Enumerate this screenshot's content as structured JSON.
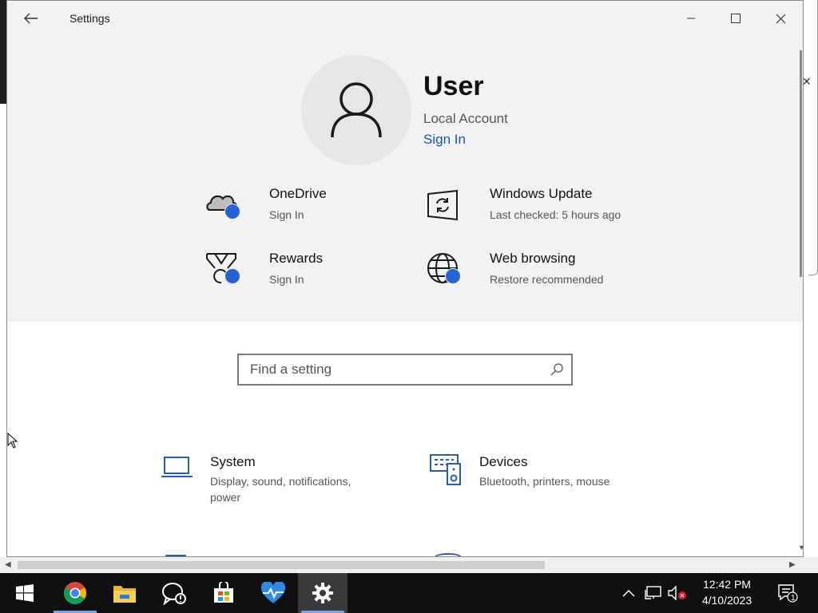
{
  "window": {
    "title": "Settings",
    "back_label": "Back",
    "minimize_label": "Minimize",
    "maximize_label": "Maximize",
    "close_label": "Close"
  },
  "profile": {
    "name": "User",
    "account_type": "Local Account",
    "sign_in": "Sign In"
  },
  "quick_tiles": [
    {
      "icon": "onedrive-cloud-icon",
      "title": "OneDrive",
      "subtitle": "Sign In"
    },
    {
      "icon": "windows-update-icon",
      "title": "Windows Update",
      "subtitle": "Last checked: 5 hours ago"
    },
    {
      "icon": "rewards-medal-icon",
      "title": "Rewards",
      "subtitle": "Sign In"
    },
    {
      "icon": "web-browsing-globe-icon",
      "title": "Web browsing",
      "subtitle": "Restore recommended"
    }
  ],
  "search": {
    "placeholder": "Find a setting"
  },
  "categories": [
    {
      "icon": "laptop-icon",
      "title": "System",
      "subtitle": "Display, sound, notifications, power"
    },
    {
      "icon": "devices-icon",
      "title": "Devices",
      "subtitle": "Bluetooth, printers, mouse"
    }
  ],
  "taskbar": {
    "apps": [
      {
        "icon": "windows-start-icon",
        "name": "Start"
      },
      {
        "icon": "chrome-icon",
        "name": "Google Chrome"
      },
      {
        "icon": "file-explorer-icon",
        "name": "File Explorer"
      },
      {
        "icon": "feedback-hub-icon",
        "name": "Feedback Hub"
      },
      {
        "icon": "microsoft-store-icon",
        "name": "Microsoft Store"
      },
      {
        "icon": "health-monitor-icon",
        "name": "Health"
      },
      {
        "icon": "settings-gear-icon",
        "name": "Settings"
      }
    ],
    "time": "12:42 PM",
    "date": "4/10/2023",
    "notification_count": "1"
  },
  "colors": {
    "accent": "#2563d6",
    "link": "#1a56a8",
    "hero_bg": "#f2f2f2",
    "taskbar_bg": "#101010"
  }
}
